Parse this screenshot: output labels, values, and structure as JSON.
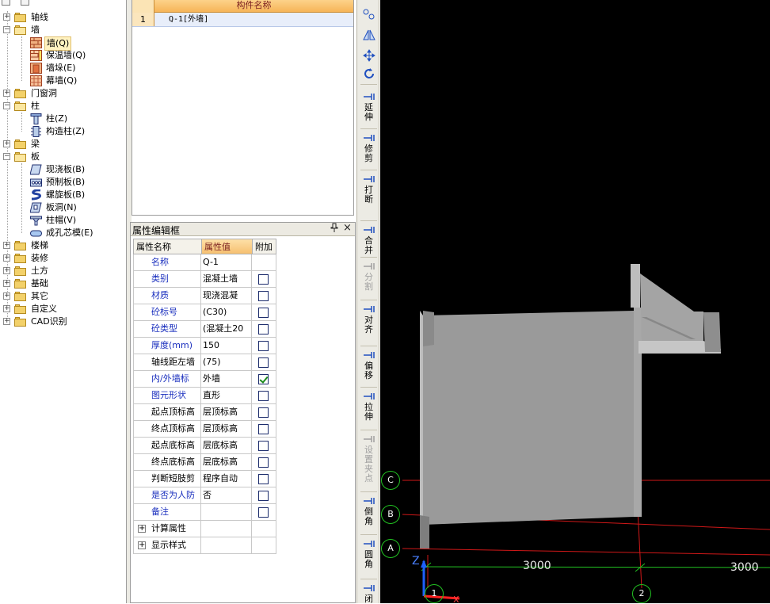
{
  "tree": {
    "items": [
      {
        "label": "轴线",
        "type": "folder",
        "expanded": false
      },
      {
        "label": "墙",
        "type": "folder",
        "expanded": true,
        "children": [
          {
            "label": "墙(Q)",
            "selected": true
          },
          {
            "label": "保温墙(Q)"
          },
          {
            "label": "墙垛(E)"
          },
          {
            "label": "幕墙(Q)"
          }
        ]
      },
      {
        "label": "门窗洞",
        "type": "folder",
        "expanded": false
      },
      {
        "label": "柱",
        "type": "folder",
        "expanded": true,
        "children": [
          {
            "label": "柱(Z)"
          },
          {
            "label": "构造柱(Z)"
          }
        ]
      },
      {
        "label": "梁",
        "type": "folder",
        "expanded": false
      },
      {
        "label": "板",
        "type": "folder",
        "expanded": true,
        "children": [
          {
            "label": "现浇板(B)"
          },
          {
            "label": "预制板(B)"
          },
          {
            "label": "螺旋板(B)"
          },
          {
            "label": "板洞(N)"
          },
          {
            "label": "柱帽(V)"
          },
          {
            "label": "成孔芯模(E)"
          }
        ]
      },
      {
        "label": "楼梯",
        "type": "folder",
        "expanded": false
      },
      {
        "label": "装修",
        "type": "folder",
        "expanded": false
      },
      {
        "label": "土方",
        "type": "folder",
        "expanded": false
      },
      {
        "label": "基础",
        "type": "folder",
        "expanded": false
      },
      {
        "label": "其它",
        "type": "folder",
        "expanded": false
      },
      {
        "label": "自定义",
        "type": "folder",
        "expanded": false
      },
      {
        "label": "CAD识别",
        "type": "folder",
        "expanded": false
      }
    ]
  },
  "component_list": {
    "header": "构件名称",
    "rows": [
      {
        "index": "1",
        "name": "Q-1[外墙]"
      }
    ]
  },
  "properties": {
    "title": "属性编辑框",
    "pin_glyph": "ᵖ",
    "close_glyph": "×",
    "col_name": "属性名称",
    "col_value": "属性值",
    "col_extra": "附加",
    "rows": [
      {
        "name": "名称",
        "value": "Q-1",
        "blue": true,
        "check": null
      },
      {
        "name": "类别",
        "value": "混凝土墙",
        "blue": true,
        "check": false
      },
      {
        "name": "材质",
        "value": "现浇混凝",
        "blue": true,
        "check": false
      },
      {
        "name": "砼标号",
        "value": "(C30)",
        "blue": true,
        "check": false
      },
      {
        "name": "砼类型",
        "value": "(混凝土20",
        "blue": true,
        "check": false
      },
      {
        "name": "厚度(mm)",
        "value": "150",
        "blue": true,
        "check": false
      },
      {
        "name": "轴线距左墙",
        "value": "(75)",
        "blue": false,
        "check": false
      },
      {
        "name": "内/外墙标",
        "value": "外墙",
        "blue": true,
        "check": true
      },
      {
        "name": "图元形状",
        "value": "直形",
        "blue": true,
        "check": false
      },
      {
        "name": "起点顶标高",
        "value": "层顶标高",
        "blue": false,
        "check": false
      },
      {
        "name": "终点顶标高",
        "value": "层顶标高",
        "blue": false,
        "check": false
      },
      {
        "name": "起点底标高",
        "value": "层底标高",
        "blue": false,
        "check": false
      },
      {
        "name": "终点底标高",
        "value": "层底标高",
        "blue": false,
        "check": false
      },
      {
        "name": "判断短肢剪",
        "value": "程序自动",
        "blue": false,
        "check": false
      },
      {
        "name": "是否为人防",
        "value": "否",
        "blue": true,
        "check": false
      },
      {
        "name": "备注",
        "value": "",
        "blue": true,
        "check": false
      }
    ],
    "groups": [
      {
        "label": "计算属性"
      },
      {
        "label": "显示样式"
      }
    ]
  },
  "toolbar": {
    "buttons": [
      {
        "label": "延伸",
        "icon": "extend-icon",
        "enabled": true
      },
      {
        "label": "修剪",
        "icon": "trim-icon",
        "enabled": true
      },
      {
        "label": "打断",
        "icon": "break-icon",
        "enabled": true
      },
      {
        "label": "合并",
        "icon": "merge-icon",
        "enabled": true
      },
      {
        "label": "分割",
        "icon": "split-icon",
        "enabled": false
      },
      {
        "label": "对齐",
        "icon": "align-icon",
        "enabled": true
      },
      {
        "label": "偏移",
        "icon": "offset-icon",
        "enabled": true
      },
      {
        "label": "拉伸",
        "icon": "stretch-icon",
        "enabled": true
      },
      {
        "label": "设置夹点",
        "icon": "grip-icon",
        "enabled": false
      },
      {
        "label": "倒角",
        "icon": "chamfer-icon",
        "enabled": true
      },
      {
        "label": "圆角",
        "icon": "fillet-icon",
        "enabled": true
      },
      {
        "label": "闭",
        "icon": "close-icon",
        "enabled": true
      }
    ]
  },
  "canvas": {
    "axes": [
      {
        "label": "C"
      },
      {
        "label": "B"
      },
      {
        "label": "A"
      },
      {
        "label": "1"
      },
      {
        "label": "2"
      }
    ],
    "dimensions": [
      "3000",
      "3000"
    ],
    "axis_z": "Z",
    "axis_x": "X",
    "colors": {
      "background": "#000000",
      "grid_line": "#d01818",
      "axis_circle": "#22c222",
      "wall": "#9a9a9a"
    }
  }
}
